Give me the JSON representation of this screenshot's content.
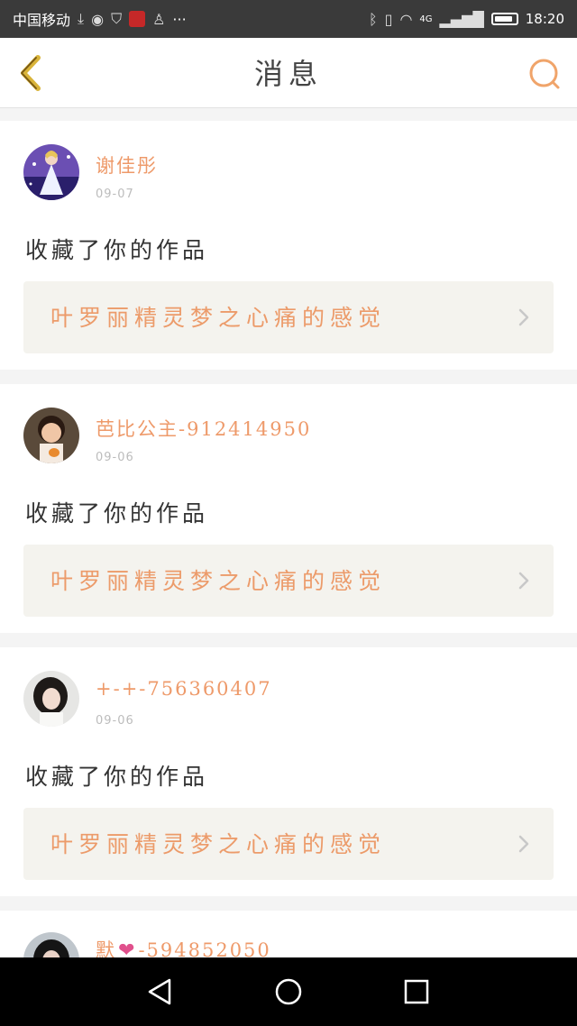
{
  "status_bar": {
    "carrier": "中国移动",
    "more": "···",
    "network": "4G",
    "time": "18:20",
    "battery_level": 0.85,
    "icons": [
      "download-icon",
      "globe-app-icon",
      "shield-app-icon",
      "red-app-icon",
      "qq-icon",
      "bluetooth-icon",
      "vibrate-icon",
      "wifi-icon",
      "signal-icon",
      "battery-icon"
    ]
  },
  "header": {
    "title": "消息",
    "back_icon": "chevron-left-icon",
    "search_icon": "search-icon"
  },
  "messages": [
    {
      "name": "谢佳彤",
      "date": "09-07",
      "action": "收藏了你的作品",
      "work": "叶罗丽精灵梦之心痛的感觉",
      "avatar": "princess-avatar"
    },
    {
      "name": "芭比公主-912414950",
      "date": "09-06",
      "action": "收藏了你的作品",
      "work": "叶罗丽精灵梦之心痛的感觉",
      "avatar": "girl-photo-avatar"
    },
    {
      "name": "+-+-756360407",
      "date": "09-06",
      "action": "收藏了你的作品",
      "work": "叶罗丽精灵梦之心痛的感觉",
      "avatar": "girl-portrait-avatar"
    },
    {
      "name": "默",
      "name_suffix": "-594852050",
      "avatar": "dark-hair-avatar"
    }
  ],
  "nav_bar": {
    "back": "triangle-back-icon",
    "home": "circle-home-icon",
    "recents": "square-recents-icon"
  },
  "colors": {
    "accent": "#ee9a6a",
    "card_bg": "#ffffff",
    "work_bg": "#f4f3ee",
    "page_bg": "#f4f4f4",
    "status_bg": "#3a3a3a"
  }
}
